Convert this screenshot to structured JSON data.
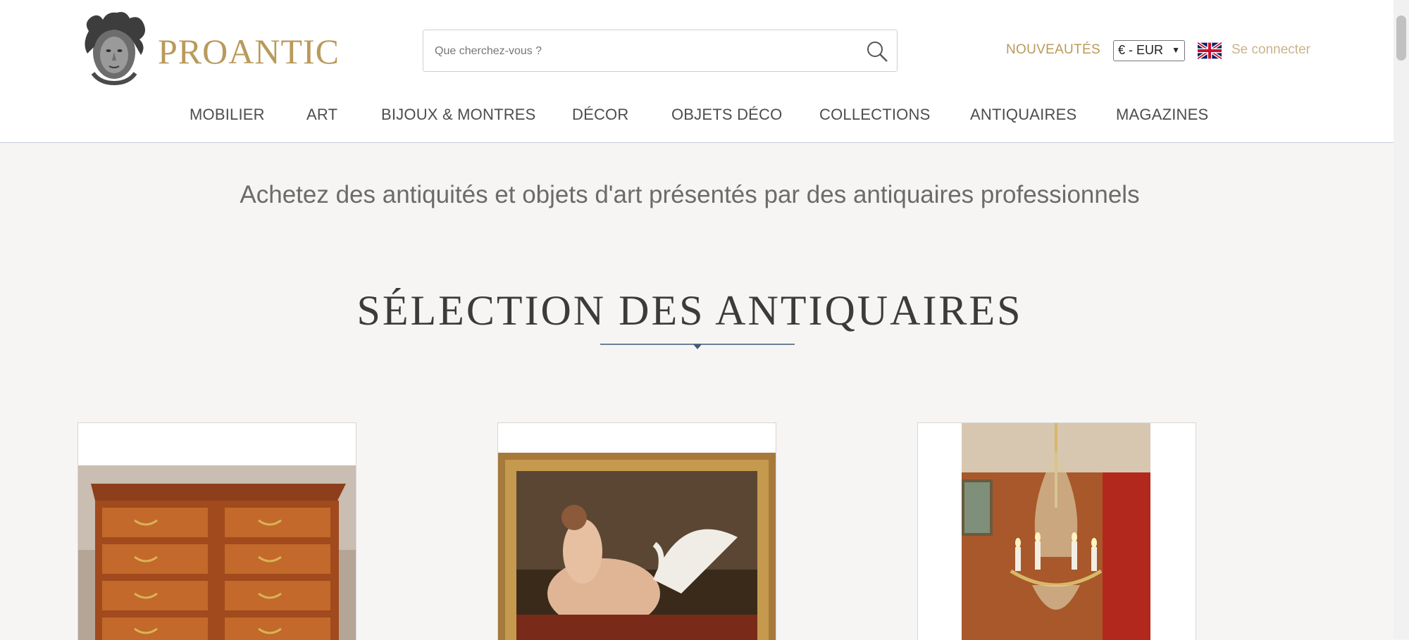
{
  "brand": {
    "name": "PROANTIC",
    "logo": "medusa-head-logo"
  },
  "search": {
    "placeholder": "Que cherchez-vous ?",
    "icon": "search-icon"
  },
  "top_links": {
    "news": "NOUVEAUTÉS",
    "currency": "€ - EUR",
    "login": "Se connecter",
    "language_flag": "uk-flag-icon"
  },
  "nav": {
    "items": [
      "MOBILIER",
      "ART",
      "BIJOUX & MONTRES",
      "DÉCOR",
      "OBJETS DÉCO",
      "COLLECTIONS",
      "ANTIQUAIRES",
      "MAGAZINES"
    ]
  },
  "main": {
    "tagline": "Achetez des antiquités et objets d'art présentés par des antiquaires professionnels",
    "section_title": "SÉLECTION DES ANTIQUAIRES"
  },
  "products": [
    {
      "name": "commode-image",
      "subject": "wooden chest of drawers"
    },
    {
      "name": "painting-image",
      "subject": "framed painting of nude with swan"
    },
    {
      "name": "chandelier-image",
      "subject": "crystal chandelier"
    }
  ],
  "colors": {
    "brand_gold": "#b99a5a",
    "nav_text": "#4d4d4d",
    "page_background": "#f7f5f4",
    "header_background": "#ffffff"
  }
}
